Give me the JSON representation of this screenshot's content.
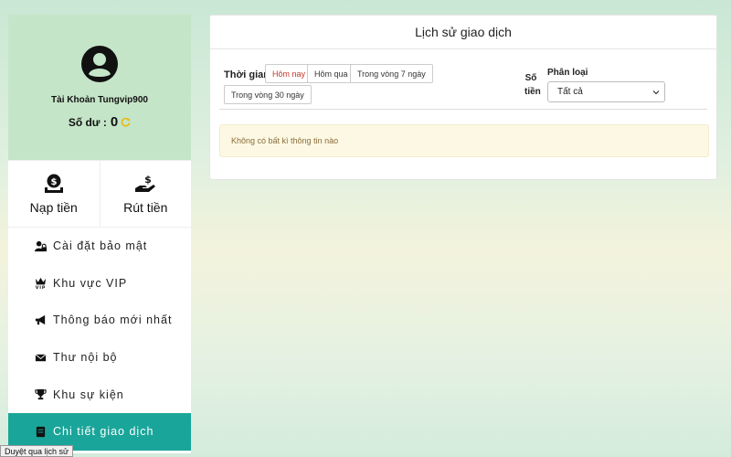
{
  "profile": {
    "account_name": "Tài Khoản Tungvip900",
    "balance_label": "Số dư :",
    "balance_value": "0"
  },
  "money": {
    "deposit_label": "Nạp tiền",
    "withdraw_label": "Rút tiền"
  },
  "menu": {
    "items": [
      {
        "label": "Cài đặt bảo mật",
        "icon": "user-lock-icon"
      },
      {
        "label": "Khu vực VIP",
        "icon": "vip-crown-icon"
      },
      {
        "label": "Thông báo mới nhất",
        "icon": "megaphone-icon"
      },
      {
        "label": "Thư nội bộ",
        "icon": "envelope-icon"
      },
      {
        "label": "Khu sự kiện",
        "icon": "trophy-icon"
      },
      {
        "label": "Chi tiết giao dịch",
        "icon": "receipt-icon",
        "active": true
      }
    ]
  },
  "panel": {
    "title": "Lịch sử giao dịch",
    "time_label": "Thời gian",
    "time_buttons": [
      "Hôm nay",
      "Hôm qua",
      "Trong vòng 7 ngày",
      "Trong vòng 30 ngày"
    ],
    "active_time": "Hôm nay",
    "amount_label": "Số tiền",
    "category_label": "Phân loại",
    "category_selected": "Tất cả",
    "empty_message": "Không có bất kì thông tin nào"
  },
  "status_bar": {
    "text": "Duyệt qua lịch sử"
  },
  "colors": {
    "accent": "#1aa59a",
    "profile_bg": "#c5e5c8",
    "refresh": "#f0b400",
    "alert_bg": "#fcf8e3",
    "alert_text": "#8a6d3b",
    "active_time": "#c0392b"
  }
}
